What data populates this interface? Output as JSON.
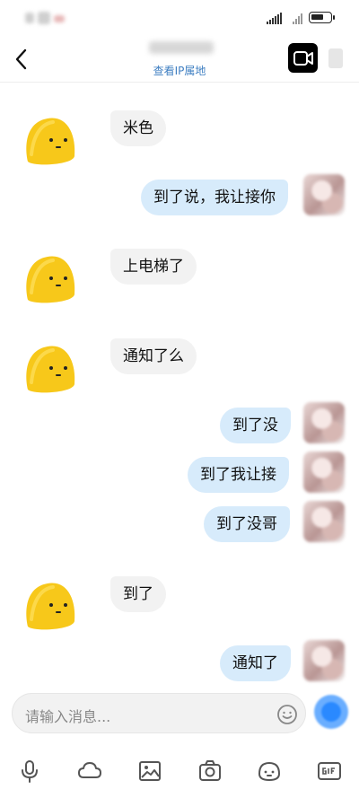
{
  "header": {
    "ip_link": "查看IP属地"
  },
  "input": {
    "placeholder": "请输入消息..."
  },
  "messages": [
    {
      "side": "in",
      "text": "米色"
    },
    {
      "side": "out",
      "text": "到了说，我让接你"
    },
    {
      "side": "in",
      "text": "上电梯了"
    },
    {
      "side": "in",
      "text": "通知了么"
    },
    {
      "side": "out",
      "text": "到了没"
    },
    {
      "side": "out",
      "text": "到了我让接"
    },
    {
      "side": "out",
      "text": "到了没哥"
    },
    {
      "side": "in",
      "text": "到了"
    },
    {
      "side": "out",
      "text": "通知了"
    }
  ],
  "toolbar": {
    "icons": [
      "microphone-icon",
      "cloud-icon",
      "image-icon",
      "camera-icon",
      "emoji-icon",
      "gif-icon"
    ]
  },
  "colors": {
    "accent": "#3f7fc2",
    "outgoing_bubble": "#d7ebfb",
    "incoming_bubble": "#f2f2f2",
    "avatar_yellow": "#f7c81a"
  }
}
